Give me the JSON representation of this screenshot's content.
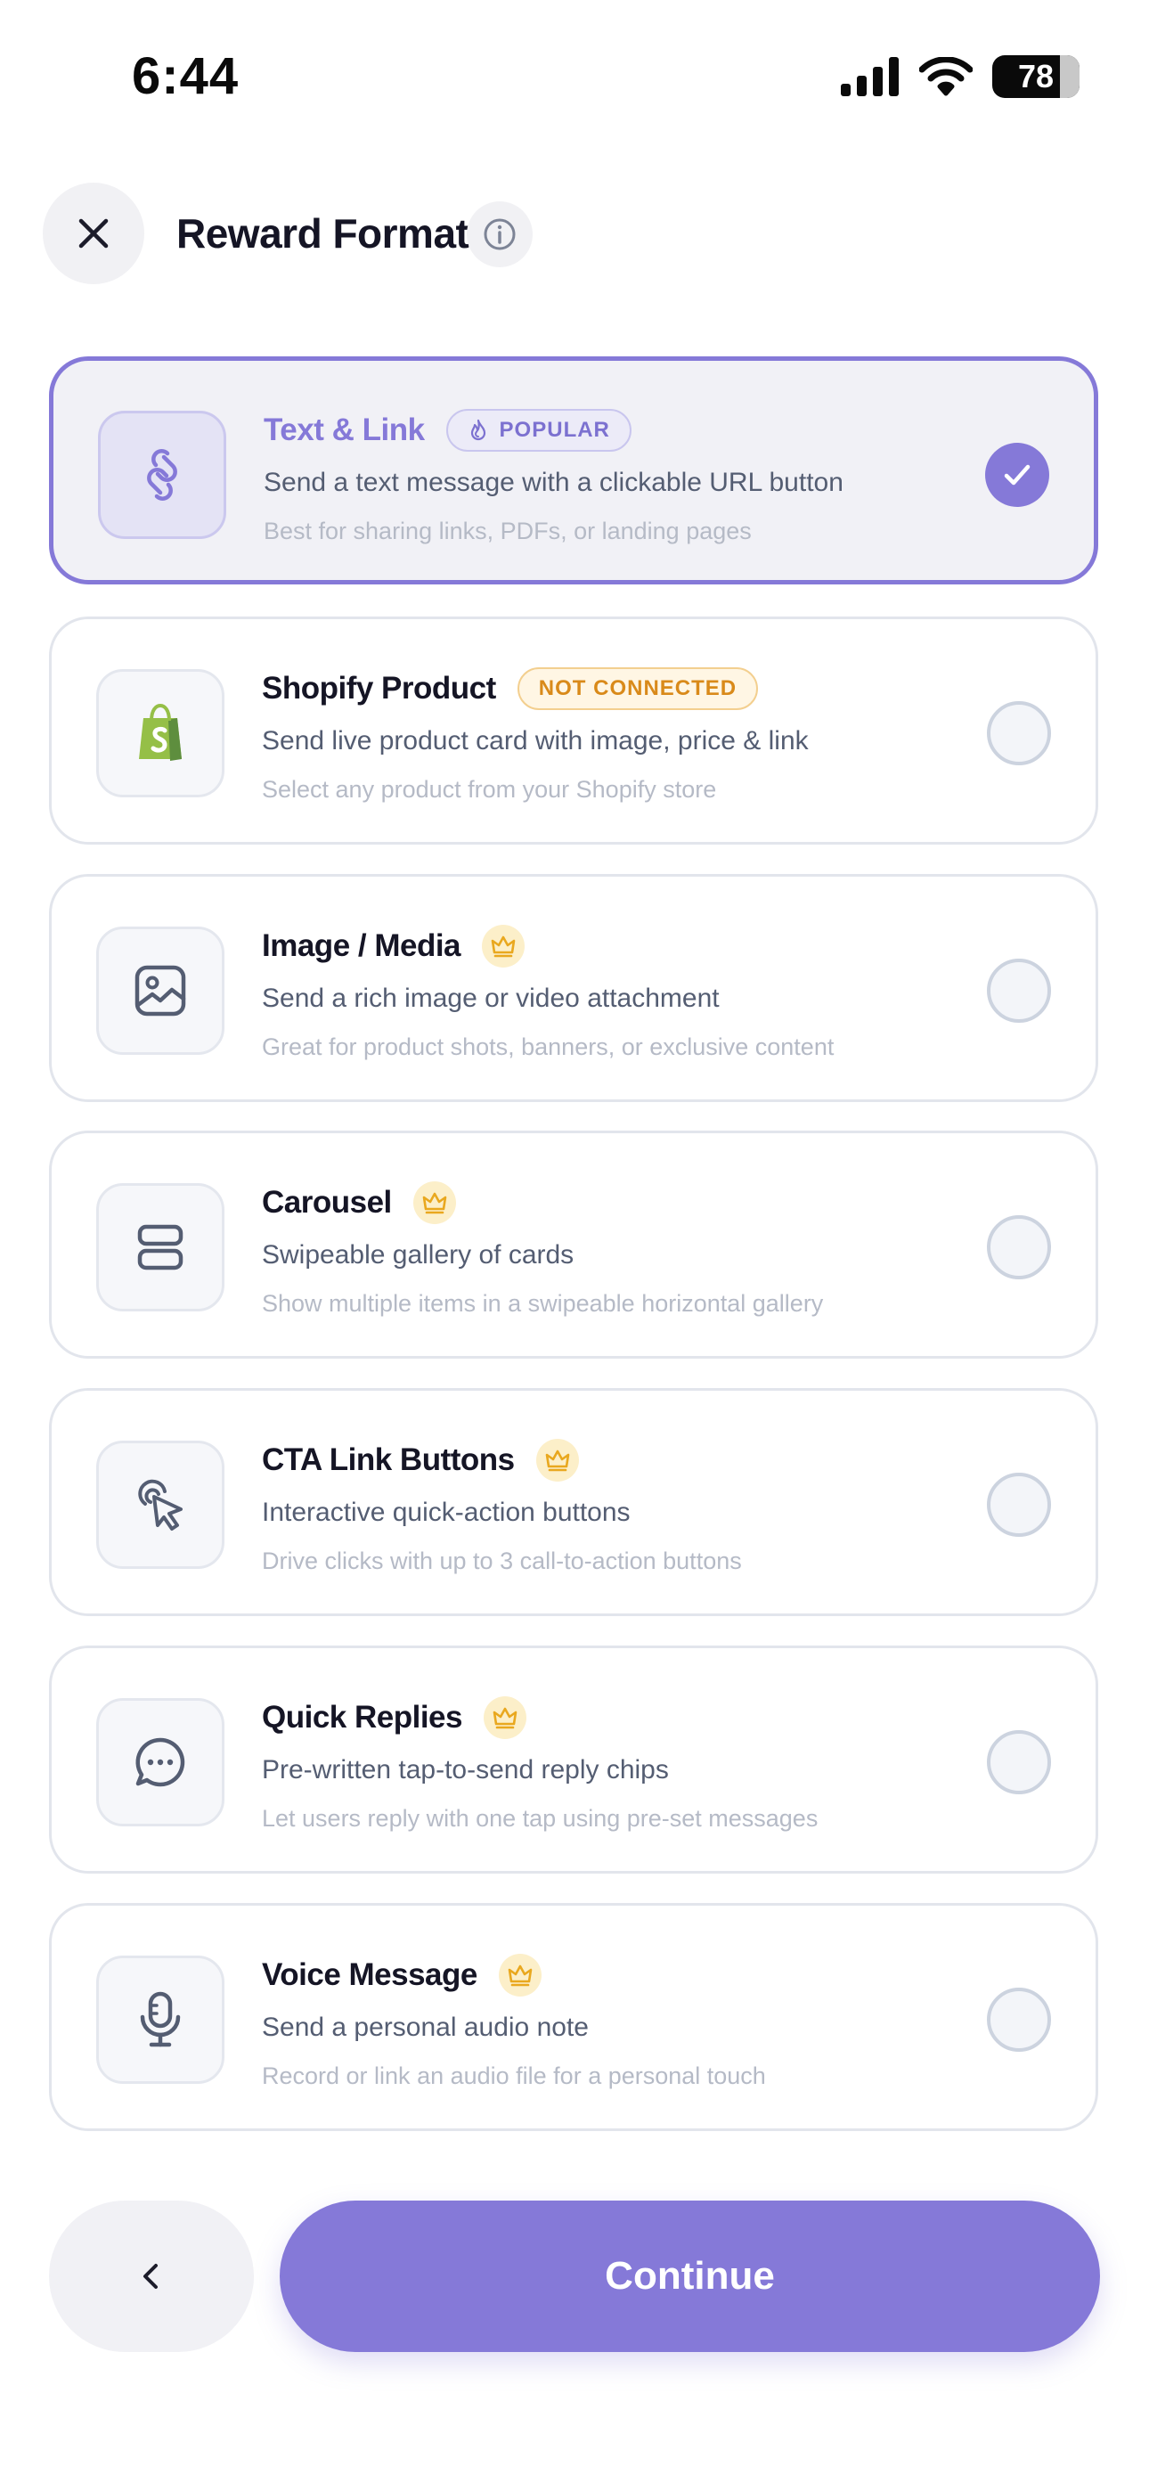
{
  "status_bar": {
    "time": "6:44",
    "battery": "78"
  },
  "header": {
    "title": "Reward Format"
  },
  "options": [
    {
      "title": "Text & Link",
      "badge": "POPULAR",
      "description": "Send a text message with a clickable URL button",
      "hint": "Best for sharing links, PDFs, or landing pages",
      "icon": "link-icon",
      "selected": true
    },
    {
      "title": "Shopify Product",
      "badge": "NOT CONNECTED",
      "description": "Send live product card with image, price & link",
      "hint": "Select any product from your Shopify store",
      "icon": "shopify-bag-icon",
      "selected": false
    },
    {
      "title": "Image / Media",
      "premium": true,
      "description": "Send a rich image or video attachment",
      "hint": "Great for product shots, banners, or exclusive content",
      "icon": "image-icon",
      "selected": false
    },
    {
      "title": "Carousel",
      "premium": true,
      "description": "Swipeable gallery of cards",
      "hint": "Show multiple items in a swipeable horizontal gallery",
      "icon": "carousel-icon",
      "selected": false
    },
    {
      "title": "CTA Link Buttons",
      "premium": true,
      "description": "Interactive quick-action buttons",
      "hint": "Drive clicks with up to 3 call-to-action buttons",
      "icon": "cursor-click-icon",
      "selected": false
    },
    {
      "title": "Quick Replies",
      "premium": true,
      "description": "Pre-written tap-to-send reply chips",
      "hint": "Let users reply with one tap using pre-set messages",
      "icon": "chat-bubble-icon",
      "selected": false
    },
    {
      "title": "Voice Message",
      "premium": true,
      "description": "Send a personal audio note",
      "hint": "Record or link an audio file for a personal touch",
      "icon": "microphone-icon",
      "selected": false
    }
  ],
  "footer": {
    "continue_label": "Continue"
  },
  "colors": {
    "accent": "#8579d8",
    "premium": "#f0b429",
    "warning": "#d98a1a",
    "shopify_green": "#95bf47"
  }
}
